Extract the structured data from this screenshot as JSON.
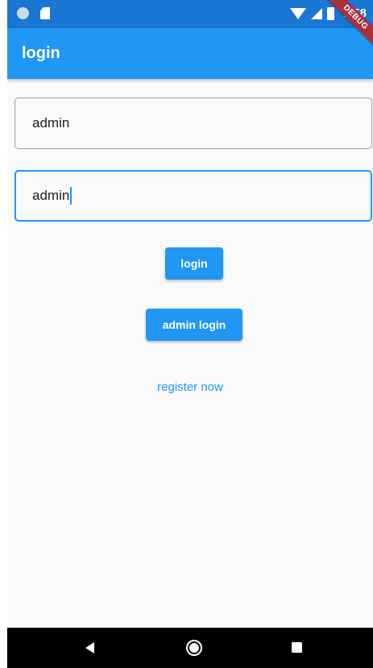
{
  "status_bar": {
    "time": "7:58",
    "debug_banner": "DEBUG",
    "icons": [
      "circle-notification-icon",
      "sd-card-icon",
      "wifi-icon",
      "signal-icon",
      "battery-icon"
    ]
  },
  "app_bar": {
    "title": "login"
  },
  "form": {
    "username_value": "admin",
    "password_value": "admin",
    "login_button": "login",
    "admin_login_button": "admin login",
    "register_link": "register now"
  },
  "nav_bar": {
    "icons": [
      "back-icon",
      "home-icon",
      "recents-icon"
    ]
  },
  "colors": {
    "primary": "#2196f3",
    "status_bar": "#1976d2",
    "background": "#fafafa"
  }
}
